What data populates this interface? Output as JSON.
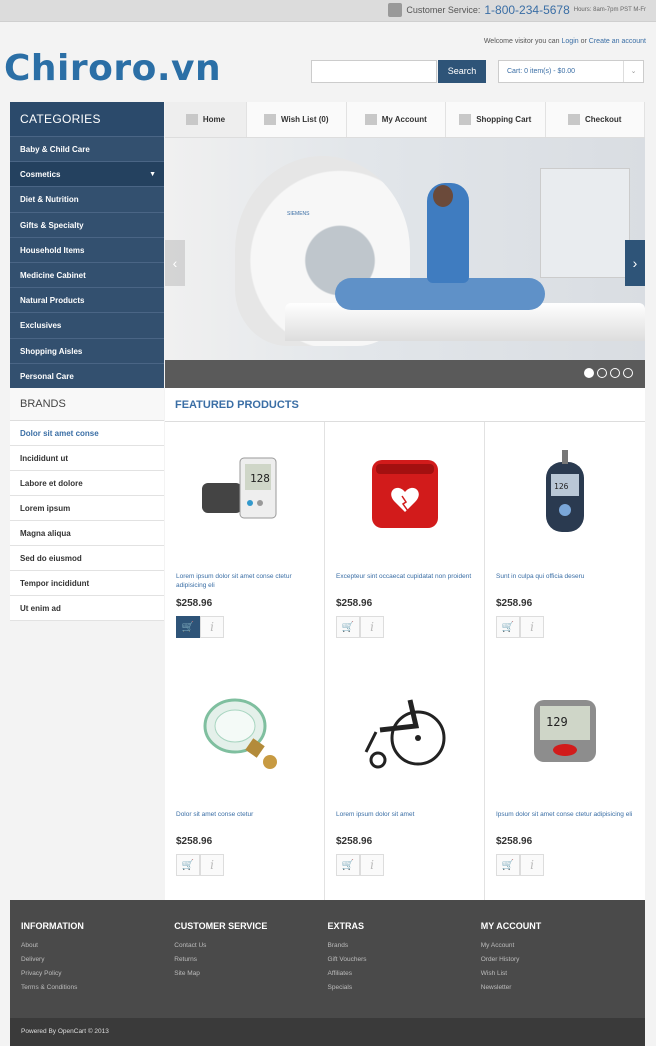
{
  "topbar": {
    "cs_label": "Customer Service:",
    "phone": "1-800-234-5678",
    "hours": "Hours: 8am-7pm PST M-Fr"
  },
  "header": {
    "logo": "Chiroro.vn",
    "welcome_pre": "Welcome visitor you can",
    "login": "Login",
    "or": "or",
    "create": "Create an account",
    "search_placeholder": "",
    "search_btn": "Search",
    "cart": "Cart: 0 item(s) - $0.00"
  },
  "categories": {
    "title": "CATEGORIES",
    "items": [
      "Baby & Child Care",
      "Cosmetics",
      "Diet & Nutrition",
      "Gifts & Specialty",
      "Household Items",
      "Medicine Cabinet",
      "Natural Products",
      "Exclusives",
      "Shopping Aisles",
      "Personal Care"
    ],
    "active_index": 1
  },
  "brands": {
    "title": "BRANDS",
    "items": [
      "Dolor sit amet conse",
      "Incididunt ut",
      "Labore et dolore",
      "Lorem ipsum",
      "Magna aliqua",
      "Sed do eiusmod",
      "Tempor incididunt",
      "Ut enim ad"
    ]
  },
  "nav": {
    "items": [
      "Home",
      "Wish List (0)",
      "My Account",
      "Shopping Cart",
      "Checkout"
    ]
  },
  "banner": {
    "brand_text": "SIEMENS",
    "dot_count": 4,
    "active_dot": 0
  },
  "featured": {
    "title": "FEATURED PRODUCTS",
    "products": [
      {
        "name": "Lorem ipsum dolor sit amet conse ctetur adipisicing eli",
        "price": "$258.96",
        "icon": "blood-pressure-monitor-icon"
      },
      {
        "name": "Excepteur sint occaecat cupidatat non proident",
        "price": "$258.96",
        "icon": "defibrillator-icon"
      },
      {
        "name": "Sunt in culpa qui officia deseru",
        "price": "$258.96",
        "icon": "glucose-meter-icon"
      },
      {
        "name": "Dolor sit amet conse ctetur",
        "price": "$258.96",
        "icon": "oxygen-mask-icon"
      },
      {
        "name": "Lorem ipsum dolor sit amet",
        "price": "$258.96",
        "icon": "wheelchair-icon"
      },
      {
        "name": "Ipsum dolor sit amet conse ctetur adipisicing eli",
        "price": "$258.96",
        "icon": "wrist-monitor-icon"
      }
    ]
  },
  "footer": {
    "columns": [
      {
        "title": "INFORMATION",
        "links": [
          "About",
          "Delivery",
          "Privacy Policy",
          "Terms & Conditions"
        ]
      },
      {
        "title": "CUSTOMER SERVICE",
        "links": [
          "Contact Us",
          "Returns",
          "Site Map"
        ]
      },
      {
        "title": "EXTRAS",
        "links": [
          "Brands",
          "Gift Vouchers",
          "Affiliates",
          "Specials"
        ]
      },
      {
        "title": "MY ACCOUNT",
        "links": [
          "My Account",
          "Order History",
          "Wish List",
          "Newsletter"
        ]
      }
    ],
    "powered": "Powered By OpenCart © 2013"
  },
  "colors": {
    "brand": "#2b6fa6",
    "sidebar": "#33506f",
    "button": "#2e5478",
    "footer": "#4a4a4a"
  }
}
